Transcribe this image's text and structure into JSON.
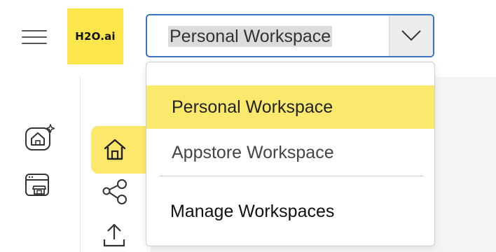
{
  "header": {
    "logo_text": "H2O.ai",
    "menu_icon": "hamburger-menu-icon"
  },
  "workspace_select": {
    "value": "Personal Workspace",
    "chevron_icon": "chevron-down-icon"
  },
  "dropdown": {
    "options": [
      {
        "label": "Personal Workspace",
        "selected": true
      },
      {
        "label": "Appstore Workspace",
        "selected": false
      }
    ],
    "manage_label": "Manage Workspaces"
  },
  "left_rail": {
    "icons": [
      "ai-home-icon",
      "app-store-icon"
    ]
  },
  "subnav": {
    "icons": [
      "home-icon",
      "connected-nodes-icon",
      "upload-icon"
    ],
    "active": "home-icon"
  },
  "colors": {
    "brand_yellow": "#fde64b",
    "selected_row": "#fbe96d",
    "focus_border": "#3b73c4"
  }
}
